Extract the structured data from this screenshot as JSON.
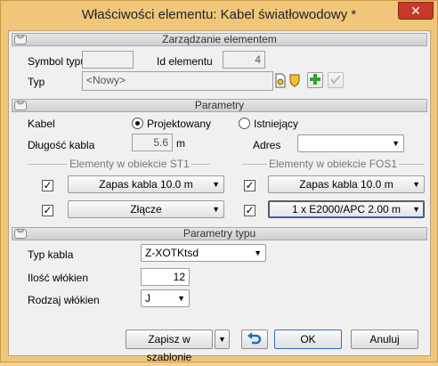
{
  "window": {
    "title": "Właściwości elementu: Kabel światłowodowy *",
    "close": "✕"
  },
  "zarzadzanie": {
    "title": "Zarządzanie elementem",
    "symbol_label": "Symbol typu",
    "symbol_value": "",
    "id_label": "Id elementu",
    "id_value": "4",
    "typ_label": "Typ",
    "typ_value": "<Nowy>"
  },
  "parametry": {
    "title": "Parametry",
    "kabel_label": "Kabel",
    "radio_projektowany": "Projektowany",
    "radio_istniejacy": "Istniejący",
    "dlugosc_label": "Długość kabla",
    "dlugosc_value": "5.6",
    "dlugosc_unit": "m",
    "adres_label": "Adres",
    "adres_value": "",
    "group_st1": "Elementy w obiekcie ST1",
    "group_fos1": "Elementy w obiekcie FOS1",
    "st1_row1": "Zapas kabla 10.0 m",
    "st1_row2": "Złącze",
    "fos1_row1": "Zapas kabla 10.0 m",
    "fos1_row2": "1 x E2000/APC 2.00 m",
    "check": "✓"
  },
  "parametry_typu": {
    "title": "Parametry typu",
    "typ_kabla_label": "Typ kabla",
    "typ_kabla_value": "Z-XOTKtsd",
    "ilosc_label": "Ilość włókien",
    "ilosc_value": "12",
    "rodzaj_label": "Rodzaj włókien",
    "rodzaj_value": "J"
  },
  "footer": {
    "zapisz": "Zapisz w szablonie",
    "ok": "OK",
    "anuluj": "Anuluj"
  },
  "colors": {
    "frame": "#f0c77a",
    "close": "#c7392b",
    "add": "#2fa52f",
    "focus": "#2b6fc4"
  }
}
